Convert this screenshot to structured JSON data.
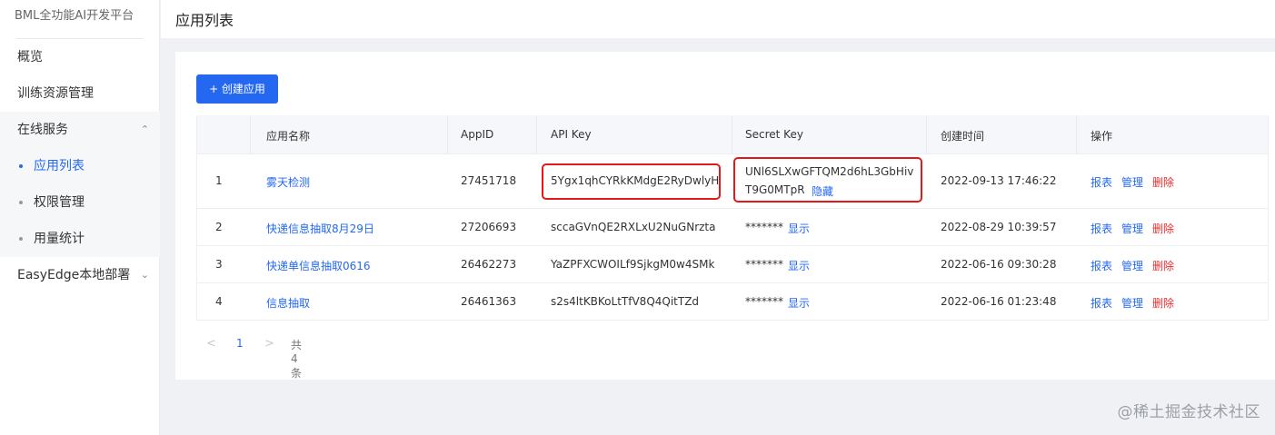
{
  "brand": "BML全功能AI开发平台",
  "header": {
    "title": "应用列表"
  },
  "sidebar": {
    "items": [
      {
        "label": "概览"
      },
      {
        "label": "训练资源管理"
      },
      {
        "label": "在线服务",
        "expanded": true
      },
      {
        "label": "应用列表",
        "active": true
      },
      {
        "label": "权限管理"
      },
      {
        "label": "用量统计"
      },
      {
        "label": "EasyEdge本地部署",
        "expanded": false
      }
    ]
  },
  "toolbar": {
    "create_label": "+ 创建应用"
  },
  "table": {
    "headers": [
      "应用名称",
      "AppID",
      "API Key",
      "Secret Key",
      "创建时间",
      "操作"
    ],
    "rows": [
      {
        "index": "1",
        "name": "雾天检测",
        "appid": "27451718",
        "api_key": "5Ygx1qhCYRkKMdgE2RyDwlyH",
        "secret_line1": "UNl6SLXwGFTQM2d6hL3GbHiv",
        "secret_line2": "T9G0MTpR",
        "secret_action": "隐藏",
        "created": "2022-09-13 17:46:22"
      },
      {
        "index": "2",
        "name": "快递信息抽取8月29日",
        "appid": "27206693",
        "api_key": "sccaGVnQE2RXLxU2NuGNrzta",
        "secret_line1": "*******",
        "secret_action": "显示",
        "created": "2022-08-29 10:39:57"
      },
      {
        "index": "3",
        "name": "快递单信息抽取0616",
        "appid": "26462273",
        "api_key": "YaZPFXCWOILf9SjkgM0w4SMk",
        "secret_line1": "*******",
        "secret_action": "显示",
        "created": "2022-06-16 09:30:28"
      },
      {
        "index": "4",
        "name": "信息抽取",
        "appid": "26461363",
        "api_key": "s2s4ltKBKoLtTfV8Q4QitTZd",
        "secret_line1": "*******",
        "secret_action": "显示",
        "created": "2022-06-16 01:23:48"
      }
    ],
    "actions": {
      "report": "报表",
      "manage": "管理",
      "delete": "删除"
    }
  },
  "pagination": {
    "prev": "<",
    "page": "1",
    "next": ">",
    "total": "共 4 条"
  },
  "watermark": "@稀土掘金技术社区",
  "colors": {
    "primary": "#2468f2",
    "danger": "#e62e2e",
    "highlight_box": "#e51818"
  }
}
